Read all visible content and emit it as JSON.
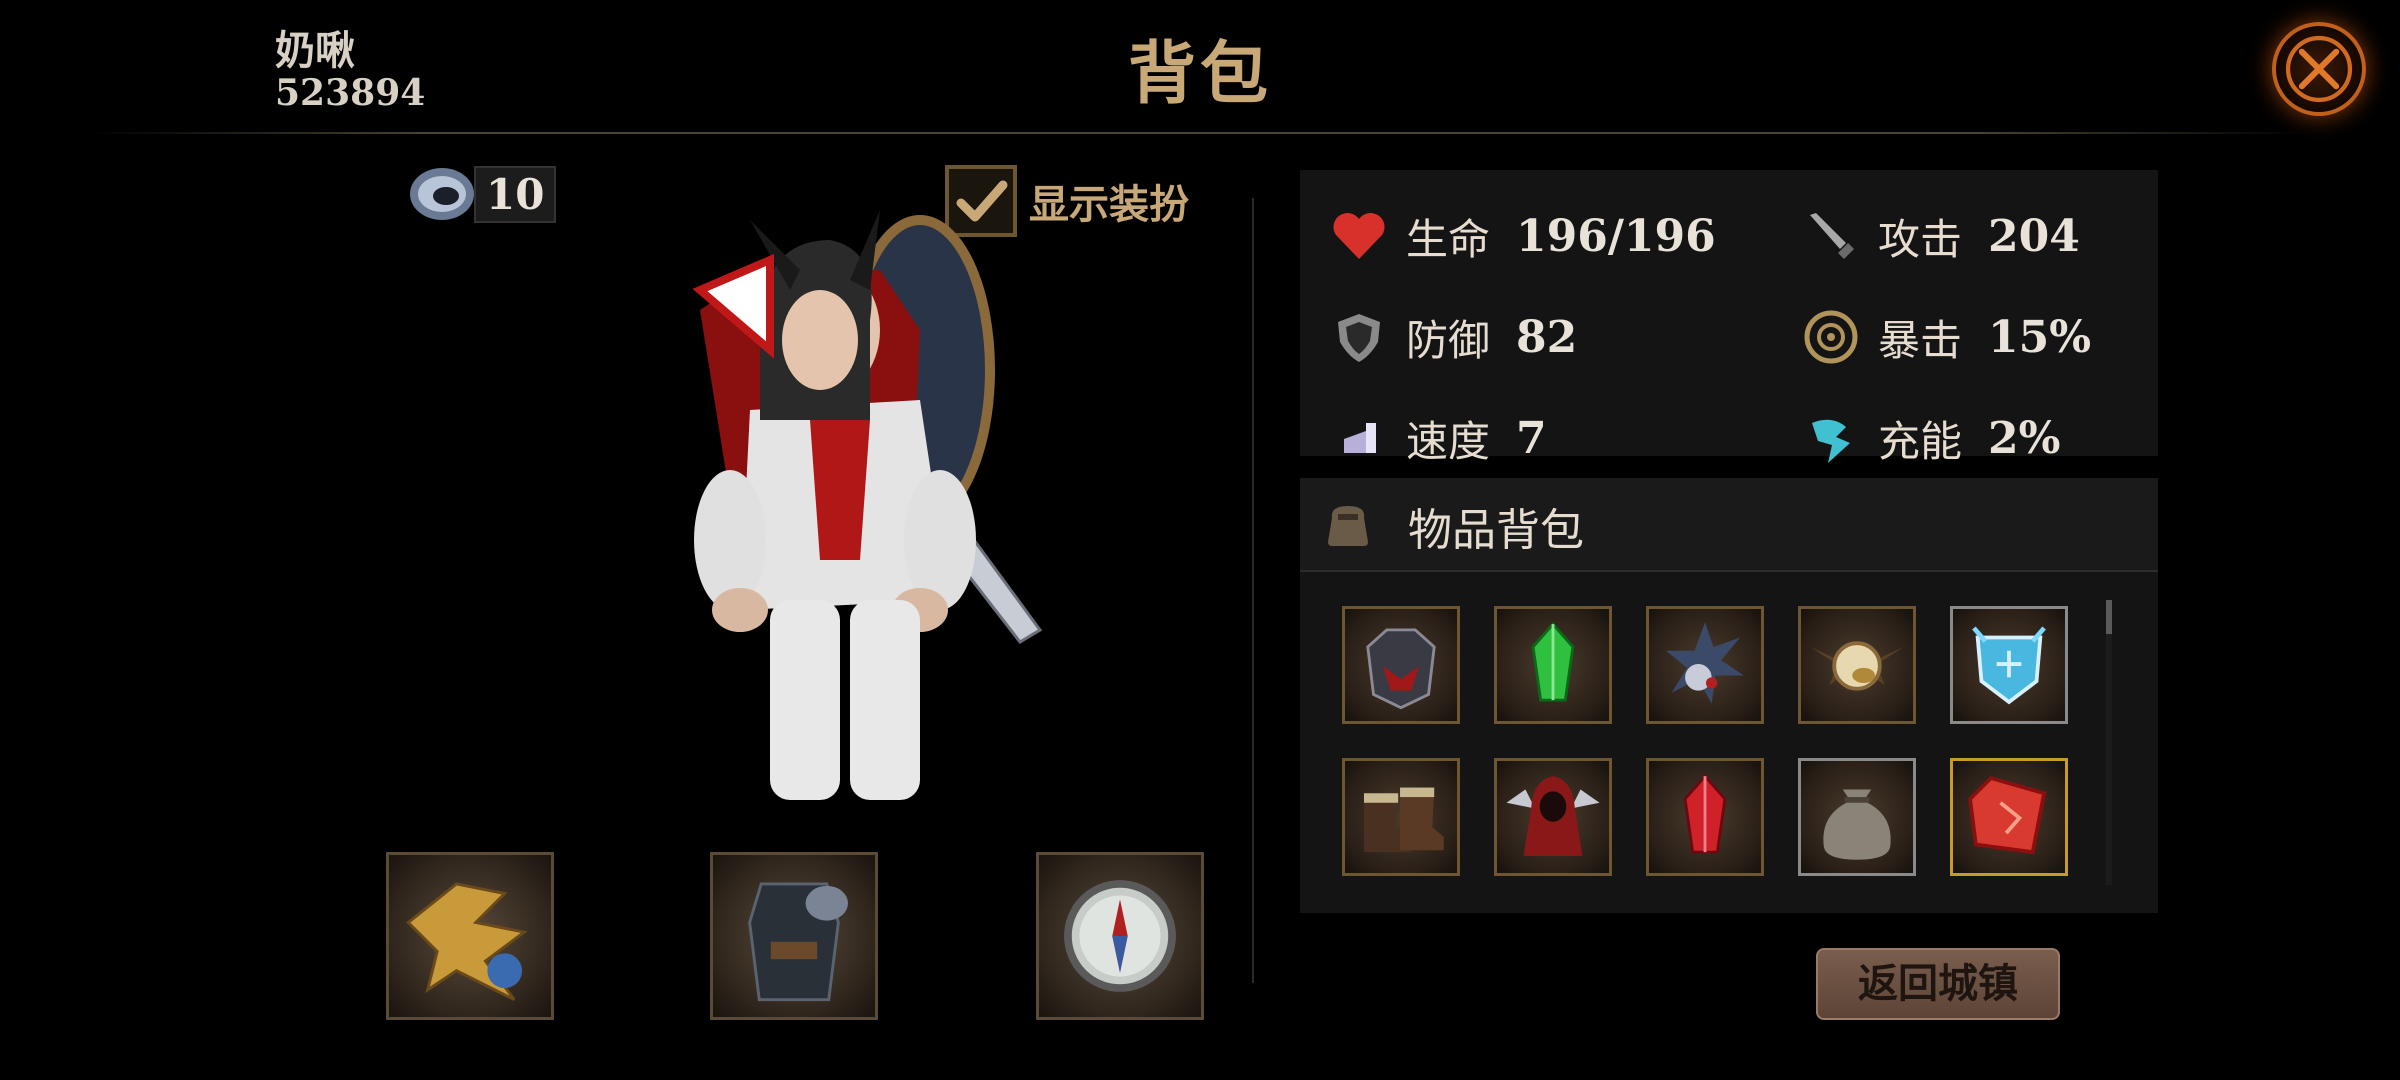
{
  "header": {
    "player_name": "奶啾",
    "player_id": "523894",
    "title": "背包"
  },
  "currency": {
    "value": "10",
    "icon": "ring-currency-icon"
  },
  "show_outfit": {
    "label": "显示装扮",
    "checked": true
  },
  "stats": [
    {
      "label": "生命",
      "value": "196/196",
      "icon": "heart-icon",
      "color": "#d8302a"
    },
    {
      "label": "攻击",
      "value": "204",
      "icon": "sword-icon",
      "color": "#9a9a9a"
    },
    {
      "label": "防御",
      "value": "82",
      "icon": "shield-icon",
      "color": "#9a9a9a"
    },
    {
      "label": "暴击",
      "value": "15%",
      "icon": "crit-icon",
      "color": "#b0945a"
    },
    {
      "label": "速度",
      "value": "7",
      "icon": "boot-icon",
      "color": "#b8b0d8"
    },
    {
      "label": "充能",
      "value": "2%",
      "icon": "energy-icon",
      "color": "#40c0d0"
    }
  ],
  "inventory": {
    "title": "物品背包",
    "icon": "pouch-icon",
    "items": [
      {
        "name": "demon-helmet",
        "frame": "bronze"
      },
      {
        "name": "green-crystal",
        "frame": "bronze"
      },
      {
        "name": "spiked-amulet",
        "frame": "bronze"
      },
      {
        "name": "bat-orb",
        "frame": "bronze"
      },
      {
        "name": "ice-shield",
        "frame": "silver"
      },
      {
        "name": "leather-boots",
        "frame": "bronze"
      },
      {
        "name": "red-hood-armor",
        "frame": "bronze"
      },
      {
        "name": "red-crystal",
        "frame": "bronze"
      },
      {
        "name": "loot-sack",
        "frame": "silver"
      },
      {
        "name": "ruby-rune",
        "frame": "gold"
      }
    ]
  },
  "equipment": [
    "golden-wing-weapon",
    "dark-armor",
    "compass"
  ],
  "return_button": {
    "label": "返回城镇"
  }
}
